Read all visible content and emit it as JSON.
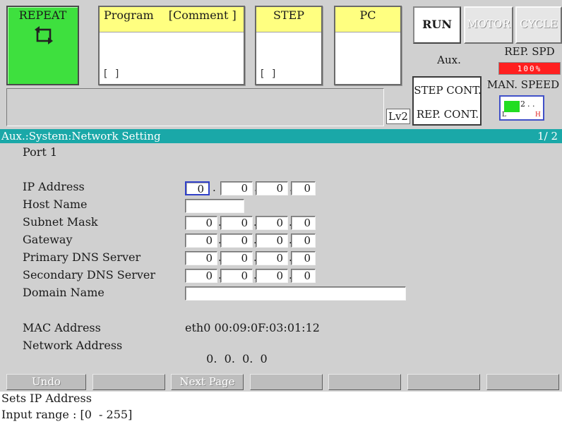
{
  "header": {
    "mode_label": "REPEAT",
    "program_label": "Program",
    "comment_label": "[Comment ]",
    "program_bracket": "[                  ]",
    "step_label": "STEP",
    "step_bracket": "[       ]",
    "pc_label": "PC",
    "run_label": "RUN",
    "motor_label": "MOTOR",
    "cycle_label": "CYCLE",
    "aux_label": "Aux.",
    "rep_spd_label": "REP. SPD",
    "rep_spd_value": "100%",
    "man_speed_label": "MAN. SPEED",
    "man_speed_value": "2",
    "man_speed_low": "L",
    "man_speed_high": "H",
    "step_cont_label": "STEP CONT.",
    "rep_cont_label": "REP. CONT.",
    "level_label": "Lv2"
  },
  "titlebar": {
    "path": "Aux.:System:Network Setting",
    "page": "1/  2"
  },
  "content": {
    "port_label": "Port 1",
    "rows": [
      {
        "label": "IP Address",
        "octets": [
          "0",
          "0",
          "0",
          "0"
        ]
      },
      {
        "label": "Host Name",
        "value": ""
      },
      {
        "label": "Subnet Mask",
        "octets": [
          "0",
          "0",
          "0",
          "0"
        ]
      },
      {
        "label": "Gateway",
        "octets": [
          "0",
          "0",
          "0",
          "0"
        ]
      },
      {
        "label": "Primary DNS Server",
        "octets": [
          "0",
          "0",
          "0",
          "0"
        ]
      },
      {
        "label": "Secondary DNS Server",
        "octets": [
          "0",
          "0",
          "0",
          "0"
        ]
      },
      {
        "label": "Domain Name",
        "value": ""
      }
    ],
    "mac_label": "MAC Address",
    "mac_value": "eth0 00:09:0F:03:01:12",
    "net_label": "Network Address",
    "net_octets": [
      "0",
      "0",
      "0",
      "0"
    ]
  },
  "fkeys": [
    "Undo",
    "",
    "Next Page",
    "",
    "",
    "",
    ""
  ],
  "status": {
    "line1": "Sets IP Address",
    "line2": "Input range : [0  - 255]"
  },
  "colors": {
    "titlebar": "#1aa8a8",
    "mode_box": "#3ee03e",
    "yellow": "#ffff80",
    "speed_red": "#ff1f1f",
    "man_green": "#22dd22"
  }
}
